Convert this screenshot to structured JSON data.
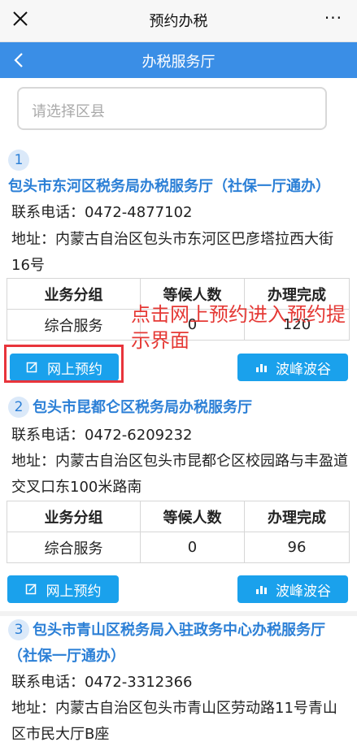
{
  "window": {
    "title": "预约办税",
    "more": "···"
  },
  "nav": {
    "title": "办税服务厅"
  },
  "district_select": {
    "placeholder": "请选择区县"
  },
  "halls": [
    {
      "index": "1",
      "name": "包头市东河区税务局办税服务厅（社保一厅通办）",
      "phone": "联系电话：0472-4877102",
      "address": "地址：内蒙古自治区包头市东河区巴彦塔拉西大街16号",
      "table_headers": [
        "业务分组",
        "等候人数",
        "办理完成"
      ],
      "rows": [
        [
          "综合服务",
          "0",
          "120"
        ]
      ],
      "book_label": "网上预约",
      "peak_label": "波峰波谷"
    },
    {
      "index": "2",
      "name": "包头市昆都仑区税务局办税服务厅",
      "phone": "联系电话：0472-6209232",
      "address": "地址：内蒙古自治区包头市昆都仑区校园路与丰盈道交叉口东100米路南",
      "table_headers": [
        "业务分组",
        "等候人数",
        "办理完成"
      ],
      "rows": [
        [
          "综合服务",
          "0",
          "96"
        ]
      ],
      "book_label": "网上预约",
      "peak_label": "波峰波谷"
    },
    {
      "index": "3",
      "name": "包头市青山区税务局入驻政务中心办税服务厅（社保一厅通办）",
      "phone": "联系电话：0472-3312366",
      "address": "地址：内蒙古自治区包头市青山区劳动路11号青山区市民大厅B座"
    }
  ],
  "annotation": {
    "text": "点击网上预约进入预约提示界面",
    "color": "#e53935"
  },
  "colors": {
    "nav": "#3a8ee6",
    "title": "#2b7fd6",
    "button": "#1aa1ec"
  }
}
